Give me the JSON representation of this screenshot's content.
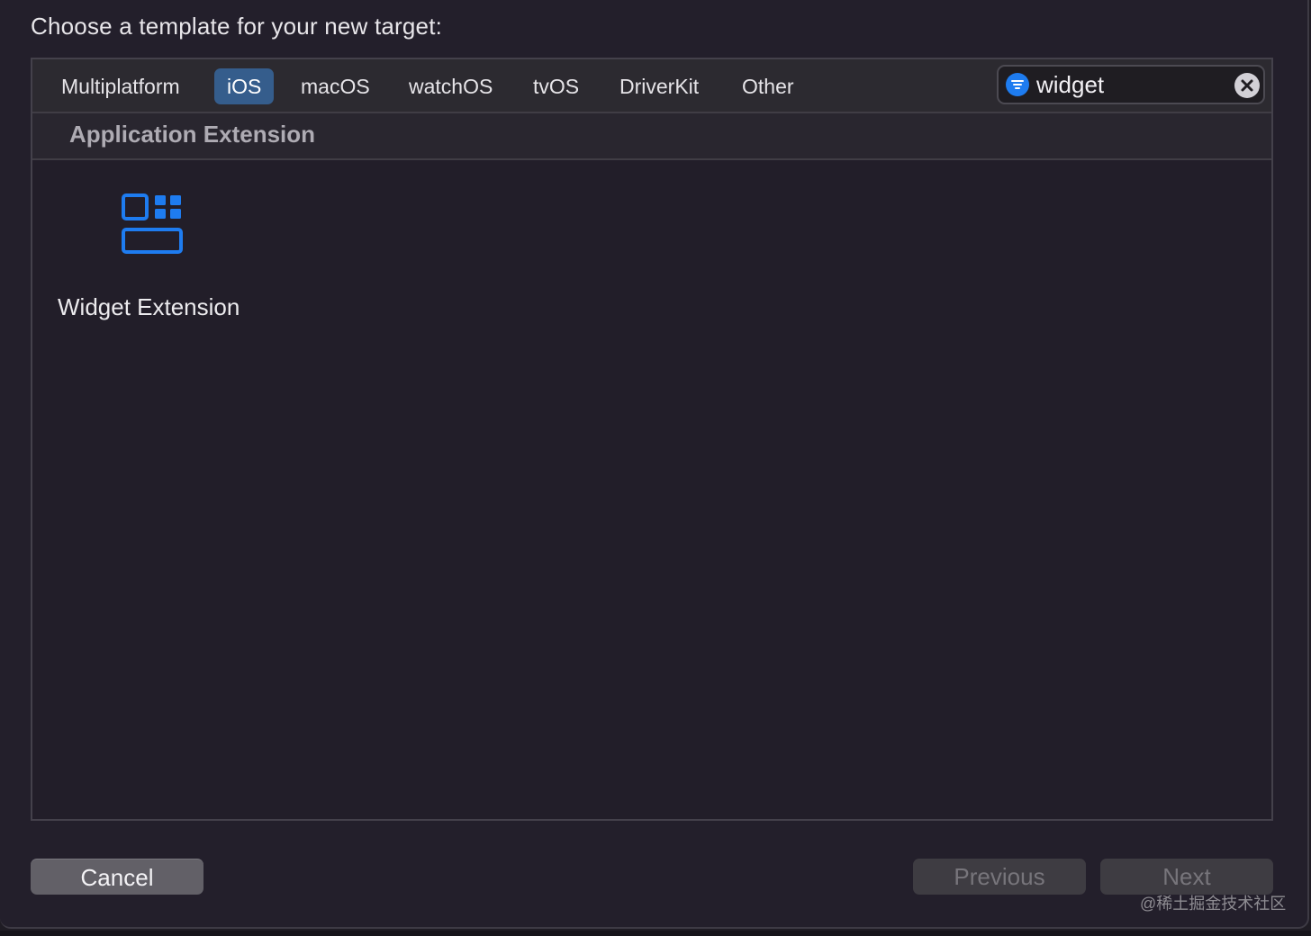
{
  "dialog": {
    "title": "Choose a template for your new target:"
  },
  "tabs": [
    {
      "label": "Multiplatform",
      "selected": false
    },
    {
      "label": "iOS",
      "selected": true
    },
    {
      "label": "macOS",
      "selected": false
    },
    {
      "label": "watchOS",
      "selected": false
    },
    {
      "label": "tvOS",
      "selected": false
    },
    {
      "label": "DriverKit",
      "selected": false
    },
    {
      "label": "Other",
      "selected": false
    }
  ],
  "search": {
    "value": "widget",
    "filter_icon": "filter-icon",
    "clear_icon": "clear-icon"
  },
  "section": {
    "title": "Application Extension"
  },
  "templates": [
    {
      "label": "Widget Extension",
      "icon": "widget-extension-icon"
    }
  ],
  "buttons": {
    "cancel": "Cancel",
    "previous": "Previous",
    "next": "Next"
  },
  "watermark": "@稀土掘金技术社区",
  "colors": {
    "accent": "#1e7cf0",
    "selected_tab": "#355d8c",
    "background": "#231f2b"
  }
}
